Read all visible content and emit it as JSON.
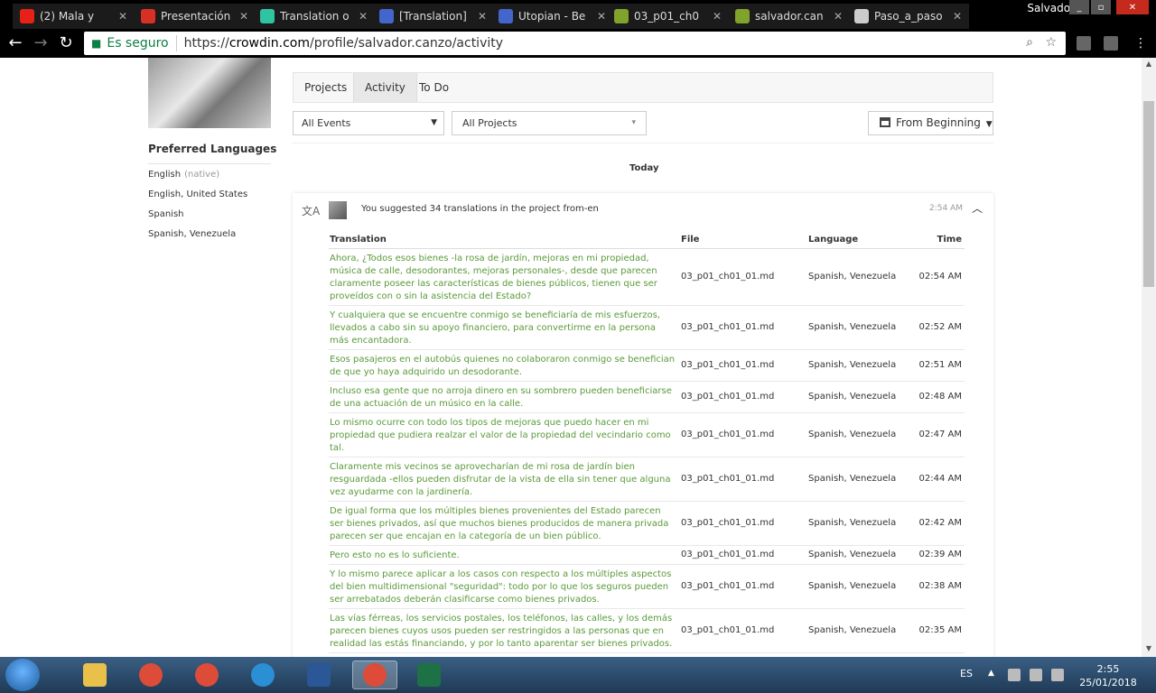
{
  "browser": {
    "tabs": [
      {
        "title": "(2) Mala y",
        "icon": "youtube-icon",
        "color": "#e62117"
      },
      {
        "title": "Presentación",
        "icon": "gmail-icon",
        "color": "#d93025"
      },
      {
        "title": "Translation o",
        "icon": "crowdin-icon",
        "color": "#2ec4a0"
      },
      {
        "title": "[Translation]",
        "icon": "utopian-icon",
        "color": "#4466cc"
      },
      {
        "title": "Utopian - Be",
        "icon": "utopian-icon",
        "color": "#4466cc"
      },
      {
        "title": "03_p01_ch0",
        "icon": "crowdin-icon",
        "color": "#7fa32b"
      },
      {
        "title": "salvador.can",
        "icon": "crowdin-icon",
        "color": "#7fa32b"
      },
      {
        "title": "Paso_a_paso",
        "icon": "document-icon",
        "color": "#cccccc"
      }
    ],
    "user": "Salvador",
    "secure_label": "Es seguro",
    "url_prefix": "https://",
    "url_host": "crowdin.com",
    "url_path": "/profile/salvador.canzo/activity"
  },
  "sidebar": {
    "preferred_title": "Preferred Languages",
    "languages": [
      {
        "name": "English",
        "note": "(native)"
      },
      {
        "name": "English, United States",
        "note": ""
      },
      {
        "name": "Spanish",
        "note": ""
      },
      {
        "name": "Spanish, Venezuela",
        "note": ""
      }
    ]
  },
  "profile_tabs": [
    "Projects",
    "Activity",
    "To Do"
  ],
  "filters": {
    "events": "All Events",
    "projects": "All Projects",
    "date": "From Beginning"
  },
  "day_label": "Today",
  "activity": {
    "summary": "You suggested 34 translations in the project from-en",
    "time": "2:54 AM",
    "columns": {
      "translation": "Translation",
      "file": "File",
      "language": "Language",
      "time": "Time"
    },
    "rows": [
      {
        "translation": "Ahora, ¿Todos esos bienes -la rosa de jardín, mejoras en mi propiedad, música de calle, desodorantes, mejoras personales-, desde que parecen claramente poseer las características de bienes públicos, tienen que ser proveídos con o sin la asistencia del Estado?",
        "file": "03_p01_ch01_01.md",
        "language": "Spanish, Venezuela",
        "time": "02:54 AM"
      },
      {
        "translation": "Y cualquiera que se encuentre conmigo se beneficiaría de mis esfuerzos, llevados a cabo sin su apoyo financiero, para convertirme en la persona más encantadora.",
        "file": "03_p01_ch01_01.md",
        "language": "Spanish, Venezuela",
        "time": "02:52 AM"
      },
      {
        "translation": "Esos pasajeros en el autobús quienes no colaboraron conmigo se benefician de que yo haya adquirido un desodorante.",
        "file": "03_p01_ch01_01.md",
        "language": "Spanish, Venezuela",
        "time": "02:51 AM"
      },
      {
        "translation": "Incluso esa gente que no arroja dinero en su sombrero pueden beneficiarse de una actuación de un músico en la calle.",
        "file": "03_p01_ch01_01.md",
        "language": "Spanish, Venezuela",
        "time": "02:48 AM"
      },
      {
        "translation": "Lo mismo ocurre con todo los tipos de mejoras que puedo hacer en mi propiedad que pudiera realzar el valor de la propiedad del vecindario como tal.",
        "file": "03_p01_ch01_01.md",
        "language": "Spanish, Venezuela",
        "time": "02:47 AM"
      },
      {
        "translation": "Claramente mis vecinos se aprovecharían de mi rosa de jardín bien resguardada -ellos pueden disfrutar de la vista de ella sin tener que alguna vez ayudarme con la jardinería.",
        "file": "03_p01_ch01_01.md",
        "language": "Spanish, Venezuela",
        "time": "02:44 AM"
      },
      {
        "translation": "De igual forma que los múltiples bienes provenientes del Estado parecen ser bienes privados, así que muchos bienes producidos de manera privada parecen ser que encajan en la categoría de un bien público.",
        "file": "03_p01_ch01_01.md",
        "language": "Spanish, Venezuela",
        "time": "02:42 AM"
      },
      {
        "translation": "Pero esto no es lo suficiente.",
        "file": "03_p01_ch01_01.md",
        "language": "Spanish, Venezuela",
        "time": "02:39 AM"
      },
      {
        "translation": "Y lo mismo parece aplicar a los casos con respecto a los múltiples aspectos del bien multidimensional \"seguridad\": todo por lo que los seguros pueden ser arrebatados deberán clasificarse como bienes privados.",
        "file": "03_p01_ch01_01.md",
        "language": "Spanish, Venezuela",
        "time": "02:38 AM"
      },
      {
        "translation": "Las vías férreas, los servicios postales, los teléfonos, las calles, y los demás parecen bienes cuyos usos pueden ser restringidos a las personas que en realidad las estás financiando, y por lo tanto aparentar ser bienes privados.",
        "file": "03_p01_ch01_01.md",
        "language": "Spanish, Venezuela",
        "time": "02:35 AM"
      }
    ]
  },
  "taskbar": {
    "apps": [
      {
        "name": "explorer-icon",
        "color": "#e8c04a"
      },
      {
        "name": "chrome-icon",
        "color": "#dd4b39"
      },
      {
        "name": "chrome-icon",
        "color": "#dd4b39"
      },
      {
        "name": "ie-icon",
        "color": "#2b8fd6"
      },
      {
        "name": "word-icon",
        "color": "#2b5797"
      },
      {
        "name": "chrome-icon",
        "color": "#dd4b39"
      },
      {
        "name": "excel-icon",
        "color": "#1e7145"
      }
    ],
    "language": "ES",
    "time": "2:55",
    "date": "25/01/2018"
  },
  "colors": {
    "translation_text": "#5a9a3a",
    "secure_green": "#0b8043"
  }
}
